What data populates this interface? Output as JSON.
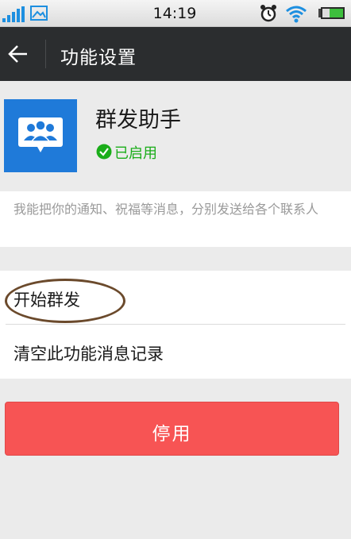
{
  "status_bar": {
    "time": "14:19",
    "icons": [
      "signal-icon",
      "gallery-icon",
      "alarm-icon",
      "wifi-icon",
      "battery-icon"
    ]
  },
  "title_bar": {
    "title": "功能设置",
    "back_icon": "back-arrow-icon"
  },
  "plugin": {
    "name": "群发助手",
    "status": "已启用",
    "icon": "group-chat-icon",
    "description": "我能把你的通知、祝福等消息，分别发送给各个联系人"
  },
  "actions": [
    {
      "label": "开始群发"
    },
    {
      "label": "清空此功能消息记录"
    }
  ],
  "disable_button": {
    "label": "停用"
  },
  "colors": {
    "title_bar_bg": "#2b2d2f",
    "accent_blue": "#1f7ad9",
    "enabled_green": "#1aad19",
    "disable_red": "#f75454",
    "annotation_brown": "#6b4a2c"
  }
}
